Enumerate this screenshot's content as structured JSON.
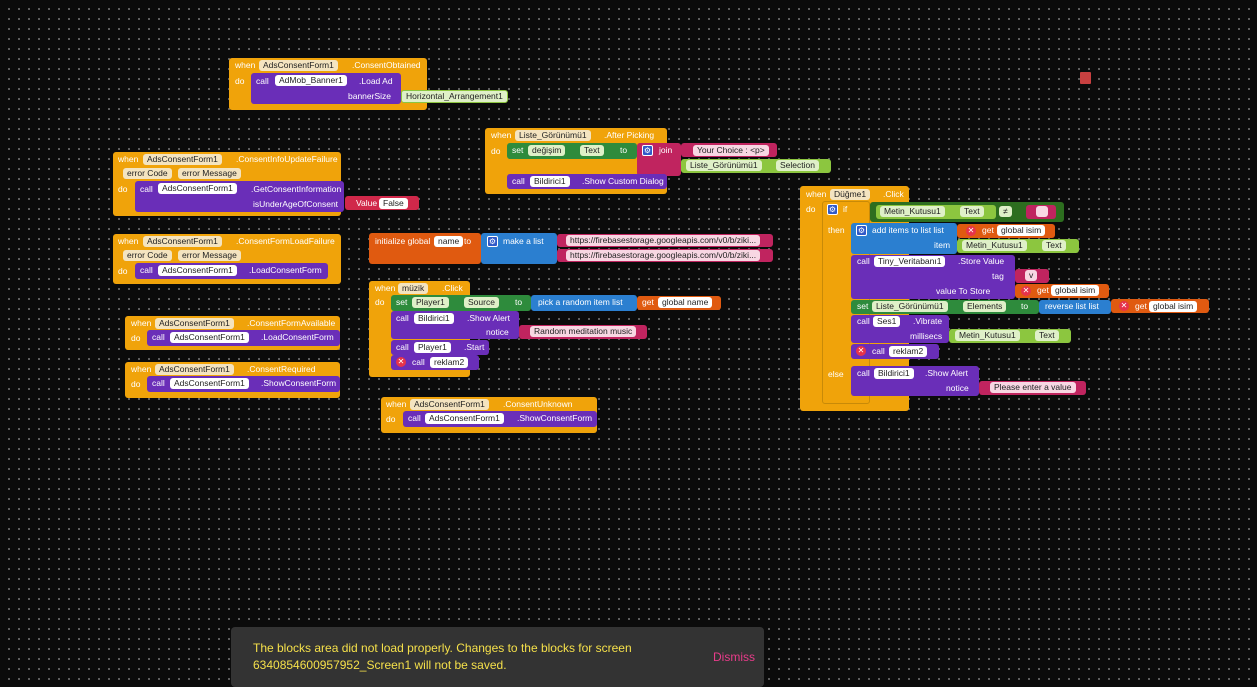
{
  "words": {
    "when": "when",
    "do": "do",
    "call": "call",
    "set": "set",
    "to": "to",
    "if": "if",
    "then": "then",
    "else": "else",
    "join": "join",
    "get": "get",
    "item": "item",
    "tag": "tag",
    "notice": "notice",
    "millisecs": "millisecs",
    "initialize_global": "initialize global",
    "make_a_list": "make a list",
    "pick_random": "pick a random item  list",
    "add_items": "add items to list   list",
    "reverse_list": "reverse list  list",
    "value_to_store": "value To Store",
    "value": "Value"
  },
  "blocks": {
    "consent_obtained": {
      "component": "AdsConsentForm1",
      "event": ".ConsentObtained",
      "target": "AdMob_Banner1",
      "method": ".Load Ad",
      "param": "bannerSize",
      "param_value": "Horizontal_Arrangement1"
    },
    "info_update_failure": {
      "component": "AdsConsentForm1",
      "event": ".ConsentInfoUpdateFailure",
      "p1": "error Code",
      "p2": "error Message",
      "target": "AdsConsentForm1",
      "method": ".GetConsentInformation",
      "param": "isUnderAgeOfConsent",
      "param_value": "False"
    },
    "form_load_failure": {
      "component": "AdsConsentForm1",
      "event": ".ConsentFormLoadFailure",
      "p1": "error Code",
      "p2": "error Message",
      "target": "AdsConsentForm1",
      "method": ".LoadConsentForm"
    },
    "form_available": {
      "component": "AdsConsentForm1",
      "event": ".ConsentFormAvailable",
      "target": "AdsConsentForm1",
      "method": ".LoadConsentForm"
    },
    "consent_required": {
      "component": "AdsConsentForm1",
      "event": ".ConsentRequired",
      "target": "AdsConsentForm1",
      "method": ".ShowConsentForm"
    },
    "consent_unknown": {
      "component": "AdsConsentForm1",
      "event": ".ConsentUnknown",
      "target": "AdsConsentForm1",
      "method": ".ShowConsentForm"
    },
    "after_picking": {
      "component": "Liste_Görünümü1",
      "event": ".After Picking",
      "set_target": "değişim",
      "set_prop": "Text",
      "join_text": "Your Choice : <p>",
      "join_comp": "Liste_Görünümü1",
      "join_prop": "Selection",
      "call_target": "Bildirici1",
      "call_method": ".Show Custom Dialog"
    },
    "init_global": {
      "name": "name",
      "url1": "https://firebasestorage.googleapis.com/v0/b/ziki...",
      "url2": "https://firebasestorage.googleapis.com/v0/b/ziki..."
    },
    "muzik_click": {
      "component": "müzik",
      "event": ".Click",
      "set_target": "Player1",
      "set_prop": "Source",
      "get_var": "global name",
      "alert_target": "Bildirici1",
      "alert_method": ".Show Alert",
      "alert_text": "Random meditation music",
      "start_target": "Player1",
      "start_method": ".Start",
      "reklam": "reklam2"
    },
    "dugme_click": {
      "component": "Düğme1",
      "event": ".Click",
      "cmp_comp": "Metin_Kutusu1",
      "cmp_prop": "Text",
      "cmp_op": "≠",
      "cmp_val": "",
      "list_var": "global isim",
      "item_comp": "Metin_Kutusu1",
      "item_prop": "Text",
      "db_target": "Tiny_Veritabanı1",
      "db_method": ".Store Value",
      "db_tag": "v",
      "db_var": "global isim",
      "set_target": "Liste_Görünümü1",
      "set_prop": "Elements",
      "rev_var": "global isim",
      "vib_target": "Ses1",
      "vib_method": ".Vibrate",
      "vib_comp": "Metin_Kutusu1",
      "vib_prop": "Text",
      "reklam": "reklam2",
      "else_target": "Bildirici1",
      "else_method": ".Show Alert",
      "else_text": "Please enter a value"
    }
  },
  "toast": {
    "message": "The blocks area did not load properly. Changes to the blocks for screen 6340854600957952_Screen1 will not be saved.",
    "dismiss": "Dismiss"
  }
}
